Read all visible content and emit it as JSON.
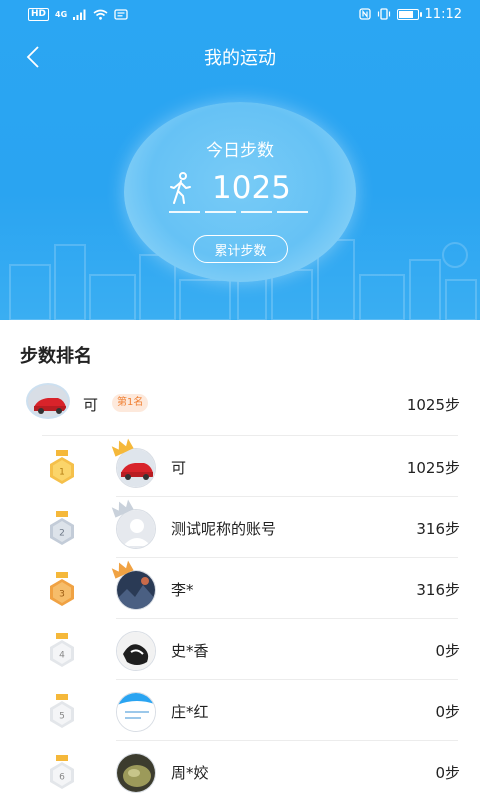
{
  "status_bar": {
    "left_badges": [
      "HD",
      "4G"
    ],
    "time": "11:12",
    "battery_level": 0.85
  },
  "nav": {
    "title": "我的运动",
    "back_icon": "chevron-left-icon"
  },
  "today": {
    "label": "今日步数",
    "steps": "1025",
    "icon": "walker-icon",
    "total_button": "累计步数"
  },
  "ranking": {
    "title": "步数排名",
    "me": {
      "name": "可",
      "rank_badge": "第1名",
      "steps": "1025步"
    },
    "items": [
      {
        "rank": "1",
        "name": "可",
        "steps": "1025步",
        "medal": "gold",
        "crown": "gold"
      },
      {
        "rank": "2",
        "name": "测试呢称的账号",
        "steps": "316步",
        "medal": "silver",
        "crown": "silver"
      },
      {
        "rank": "3",
        "name": "李*",
        "steps": "316步",
        "medal": "bronze",
        "crown": "bronze"
      },
      {
        "rank": "4",
        "name": "史*香",
        "steps": "0步",
        "medal": "plain"
      },
      {
        "rank": "5",
        "name": "庄*红",
        "steps": "0步",
        "medal": "plain"
      },
      {
        "rank": "6",
        "name": "周*姣",
        "steps": "0步",
        "medal": "plain"
      }
    ]
  },
  "colors": {
    "primary": "#2aa4f1",
    "gold": "#f5b83a",
    "silver": "#c9d1db",
    "bronze": "#f0a243",
    "rank_badge_text": "#f08034"
  }
}
